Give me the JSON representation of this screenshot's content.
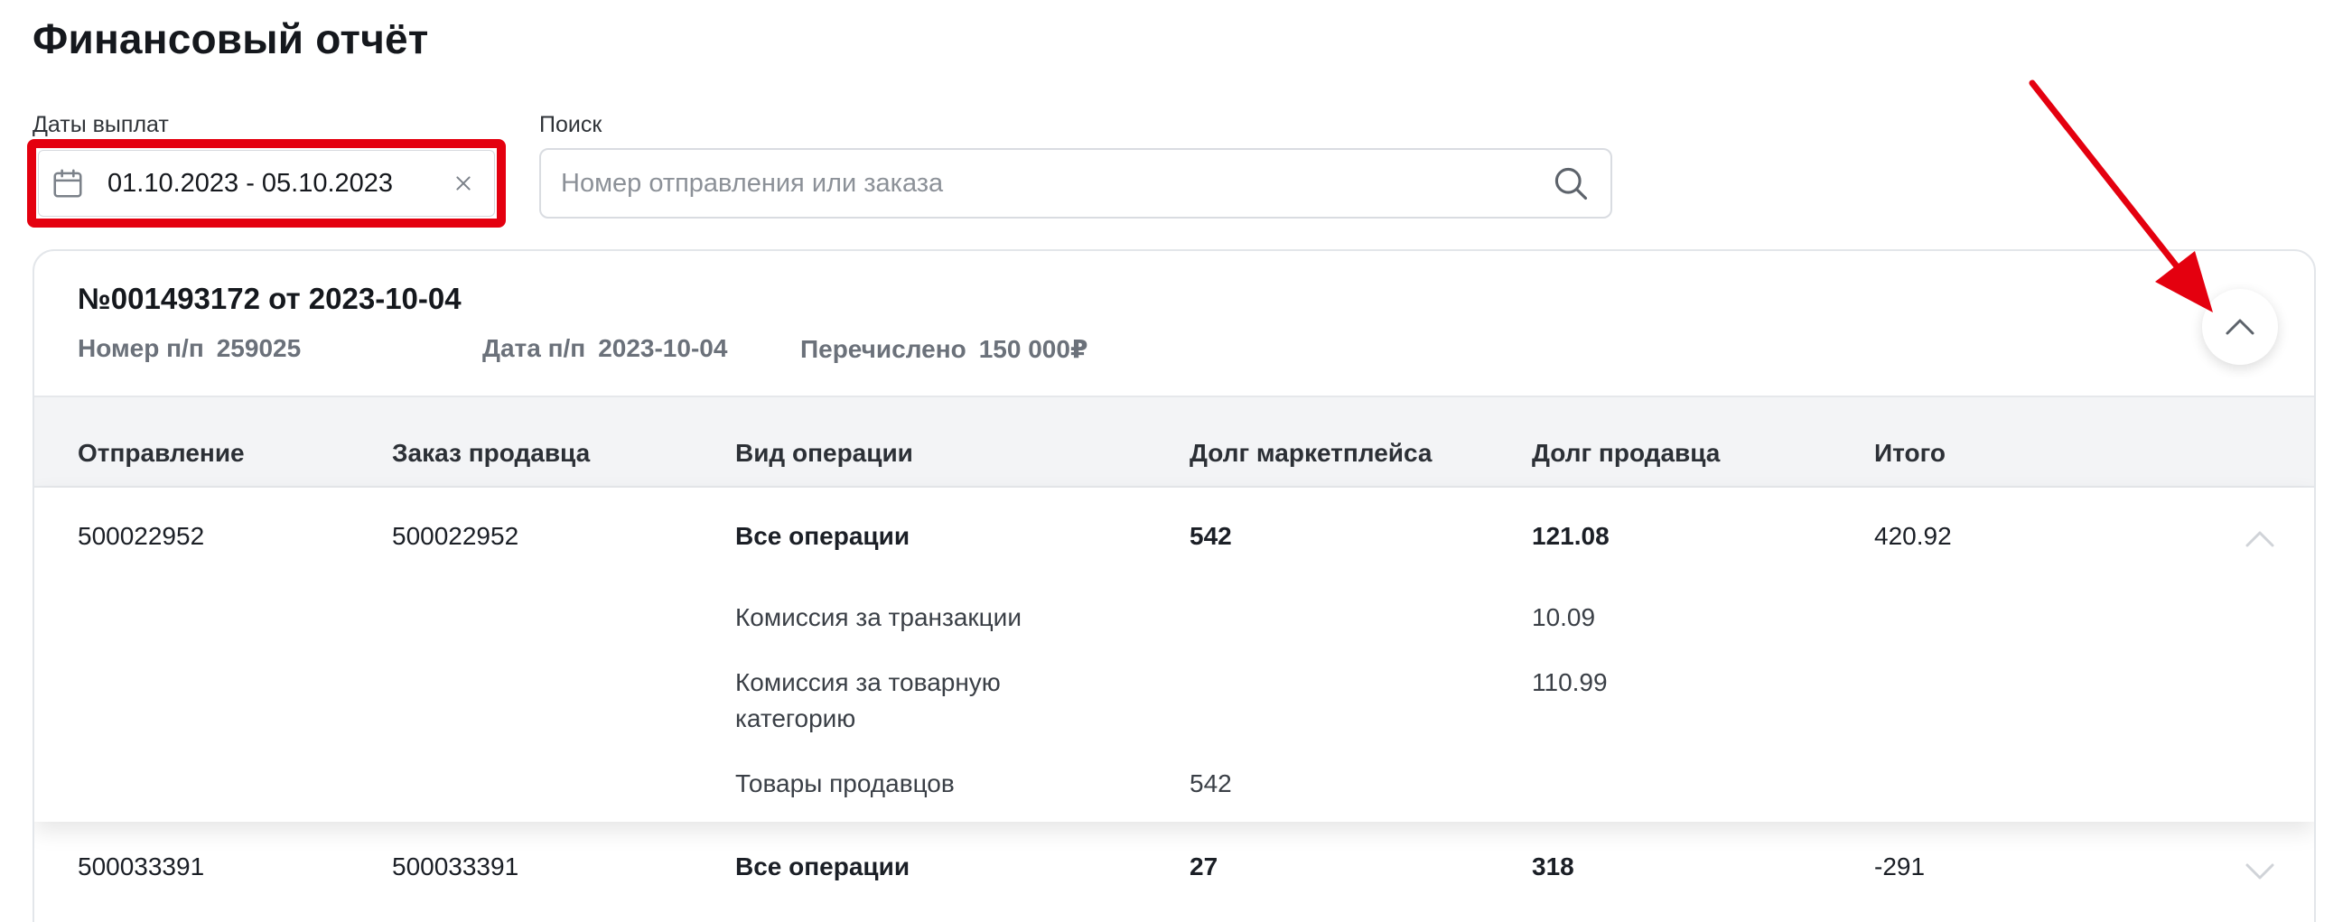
{
  "page_title": "Финансовый отчёт",
  "filters": {
    "dates_label": "Даты выплат",
    "dates_value": "01.10.2023 - 05.10.2023",
    "search_label": "Поиск",
    "search_placeholder": "Номер отправления или заказа",
    "search_value": ""
  },
  "payment": {
    "title": "№001493172 от 2023-10-04",
    "pp_number_label": "Номер п/п",
    "pp_number": "259025",
    "pp_date_label": "Дата п/п",
    "pp_date": "2023-10-04",
    "transferred_label": "Перечислено",
    "transferred": "150 000₽"
  },
  "table": {
    "headers": [
      "Отправление",
      "Заказ продавца",
      "Вид операции",
      "Долг маркетплейса",
      "Долг продавца",
      "Итого"
    ],
    "rows": [
      {
        "shipment": "500022952",
        "order": "500022952",
        "operation": "Все операции",
        "marketplace_debt": "542",
        "seller_debt": "121.08",
        "total": "420.92",
        "expanded": true,
        "details": [
          {
            "operation": "Комиссия за транзакции",
            "marketplace_debt": "",
            "seller_debt": "10.09"
          },
          {
            "operation_line1": "Комиссия за товарную",
            "operation_line2": "категорию",
            "marketplace_debt": "",
            "seller_debt": "110.99"
          },
          {
            "operation": "Товары продавцов",
            "marketplace_debt": "542",
            "seller_debt": ""
          }
        ]
      },
      {
        "shipment": "500033391",
        "order": "500033391",
        "operation": "Все операции",
        "marketplace_debt": "27",
        "seller_debt": "318",
        "total": "-291",
        "expanded": false
      }
    ]
  },
  "colors": {
    "highlight": "#e4000f",
    "header_bg": "#f3f4f6",
    "muted_text": "#6b717a"
  },
  "icons": {
    "date_field": "calendar-icon",
    "clear": "close-icon",
    "search": "search-icon",
    "collapse": "chevron-up-icon",
    "row_expanded": "chevron-up-icon",
    "row_collapsed": "chevron-down-icon"
  }
}
